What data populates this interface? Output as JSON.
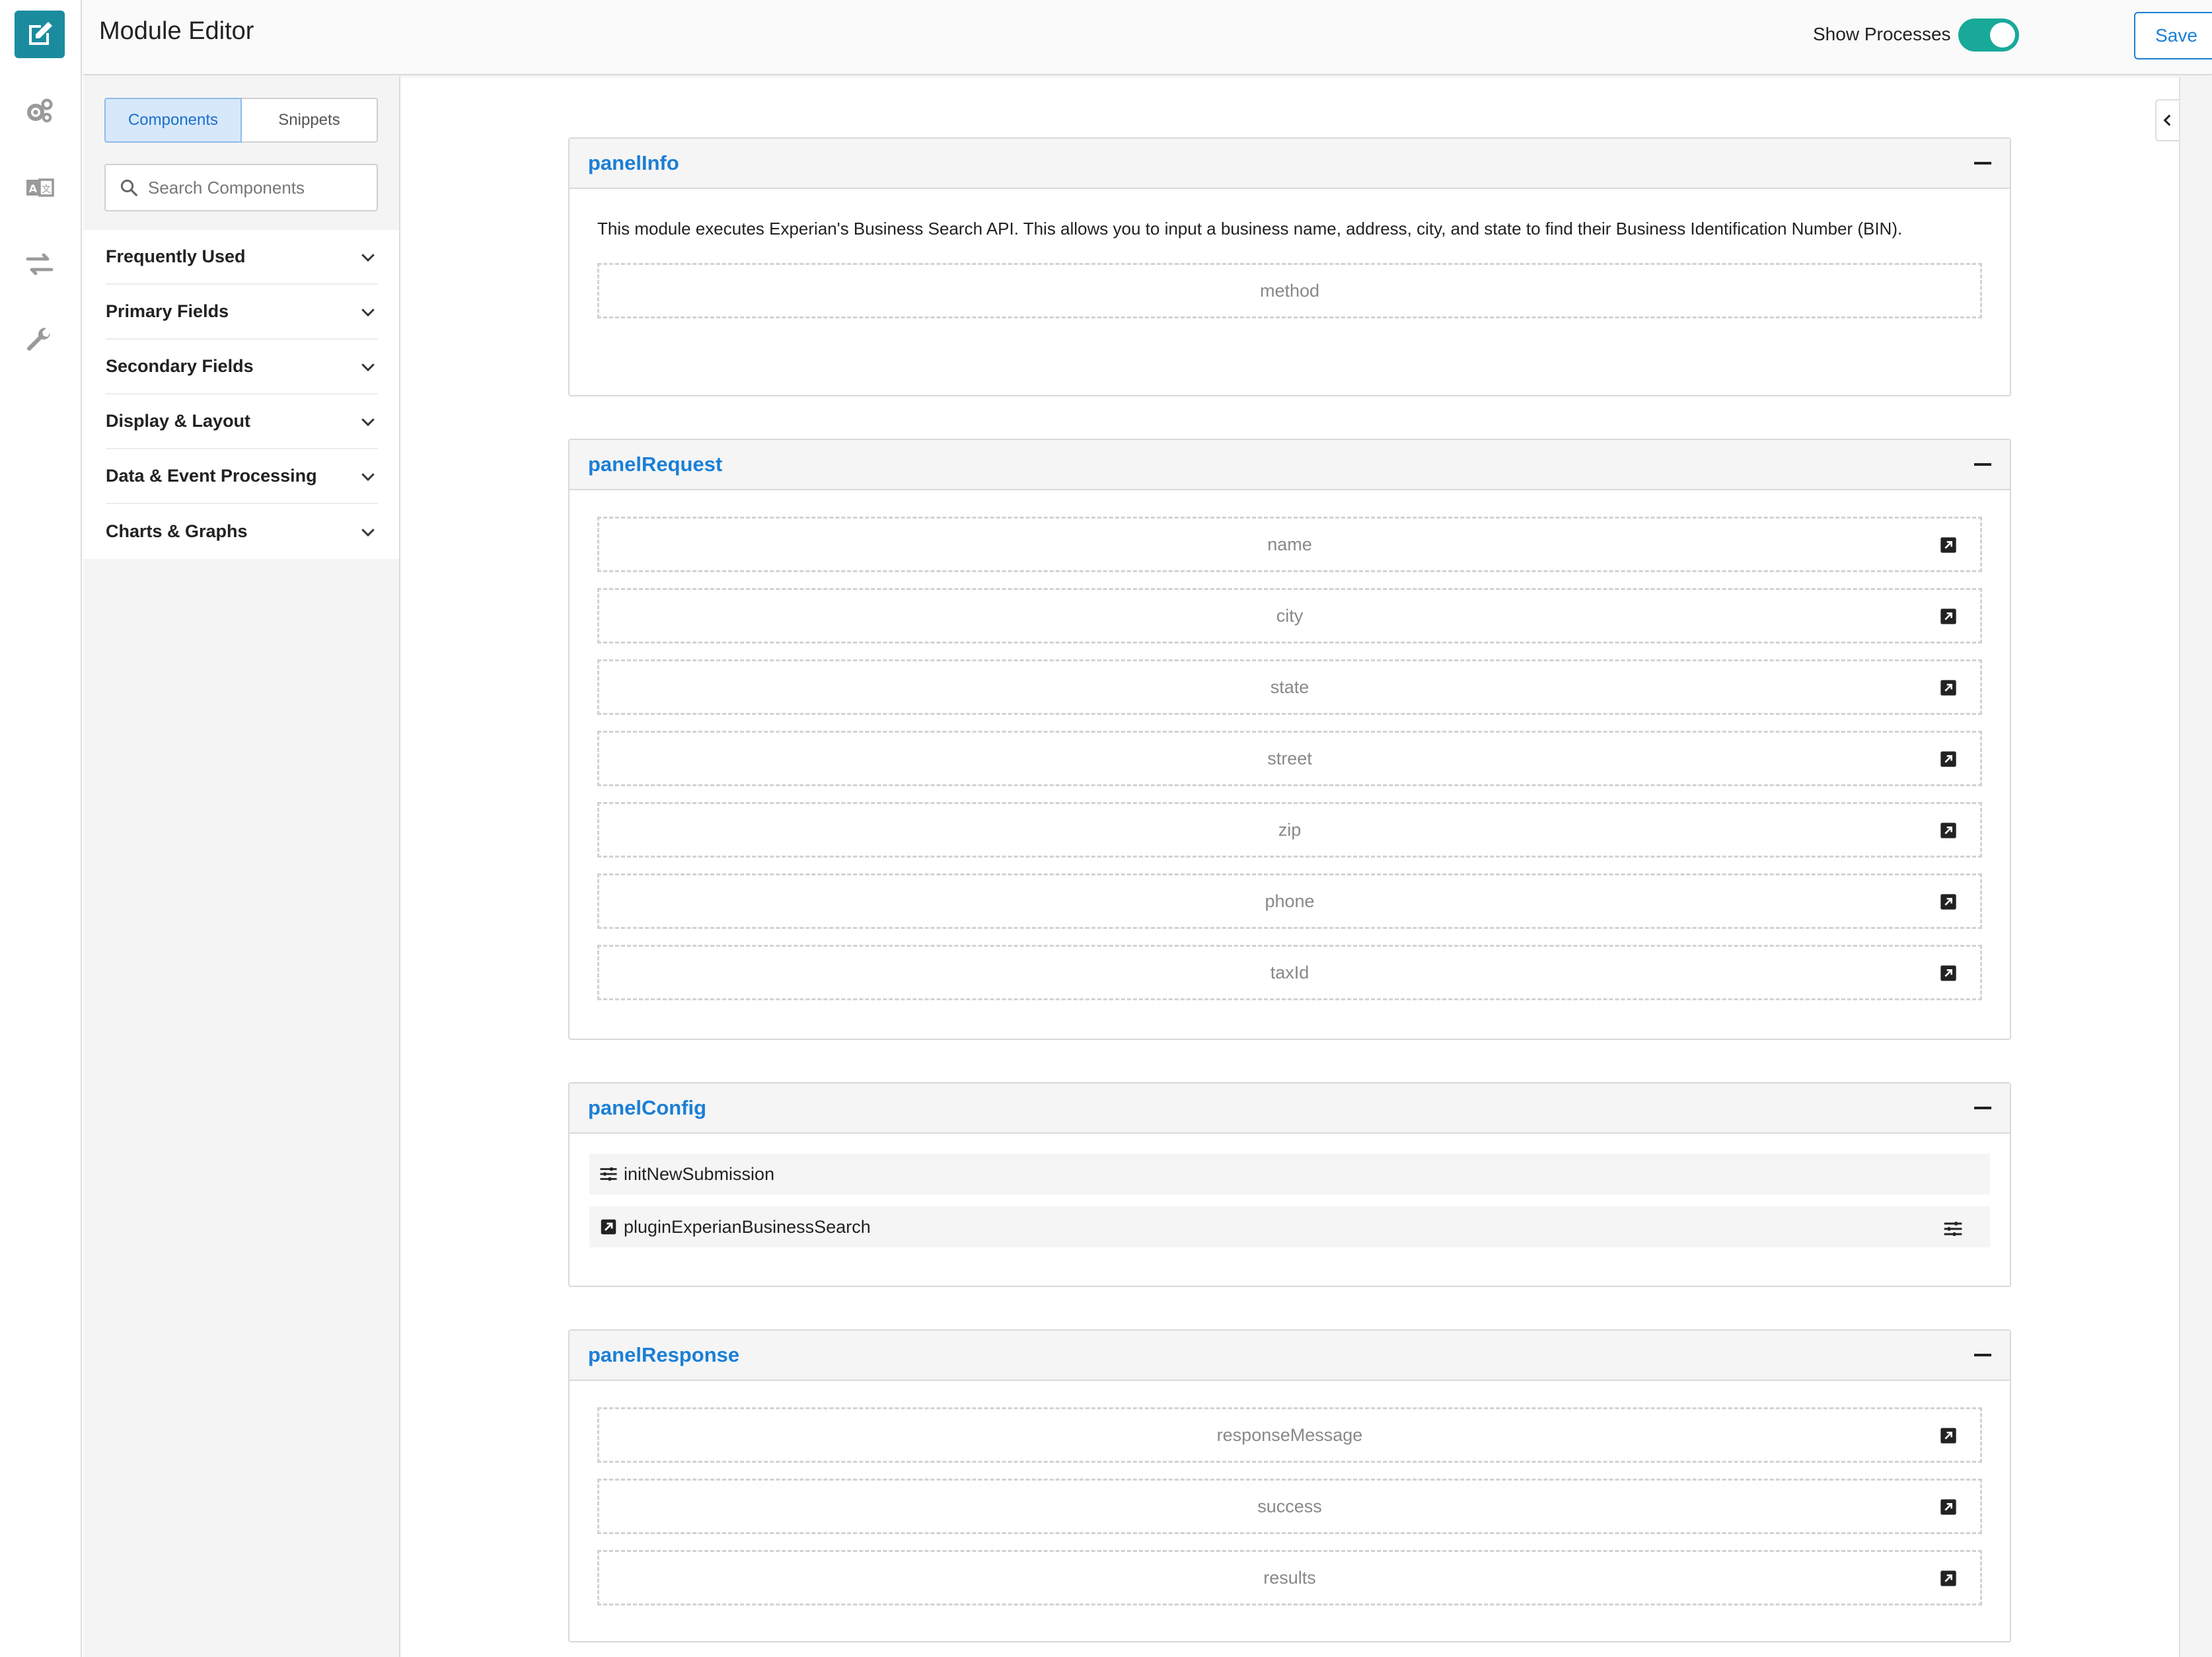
{
  "header": {
    "title": "Module Editor",
    "show_processes_label": "Show Processes",
    "show_processes_on": true,
    "save_label": "Save",
    "more_label": "•••"
  },
  "rail": {
    "icons": [
      "edit-icon",
      "gears-icon",
      "translate-icon",
      "arrows-exchange-icon",
      "wrench-icon"
    ],
    "accent": "#1a8c9e"
  },
  "sidebar": {
    "tabs": [
      {
        "label": "Components",
        "active": true
      },
      {
        "label": "Snippets",
        "active": false
      }
    ],
    "search_placeholder": "Search Components",
    "categories": [
      {
        "label": "Frequently Used"
      },
      {
        "label": "Primary Fields"
      },
      {
        "label": "Secondary Fields"
      },
      {
        "label": "Display & Layout"
      },
      {
        "label": "Data & Event Processing"
      },
      {
        "label": "Charts & Graphs"
      }
    ]
  },
  "panels": {
    "info": {
      "title": "panelInfo",
      "text": "This module executes Experian's Business Search API. This allows you to input a business name, address, city, and state to find their Business Identification Number (BIN).",
      "fields": [
        "method"
      ]
    },
    "request": {
      "title": "panelRequest",
      "fields": [
        "name",
        "city",
        "state",
        "street",
        "zip",
        "phone",
        "taxId"
      ]
    },
    "config": {
      "title": "panelConfig",
      "processes": [
        "initNewSubmission",
        "pluginExperianBusinessSearch"
      ]
    },
    "response": {
      "title": "panelResponse",
      "fields": [
        "responseMessage",
        "success",
        "results"
      ]
    }
  },
  "colors": {
    "link_blue": "#1b7fd6",
    "toggle_teal": "#18a999"
  }
}
